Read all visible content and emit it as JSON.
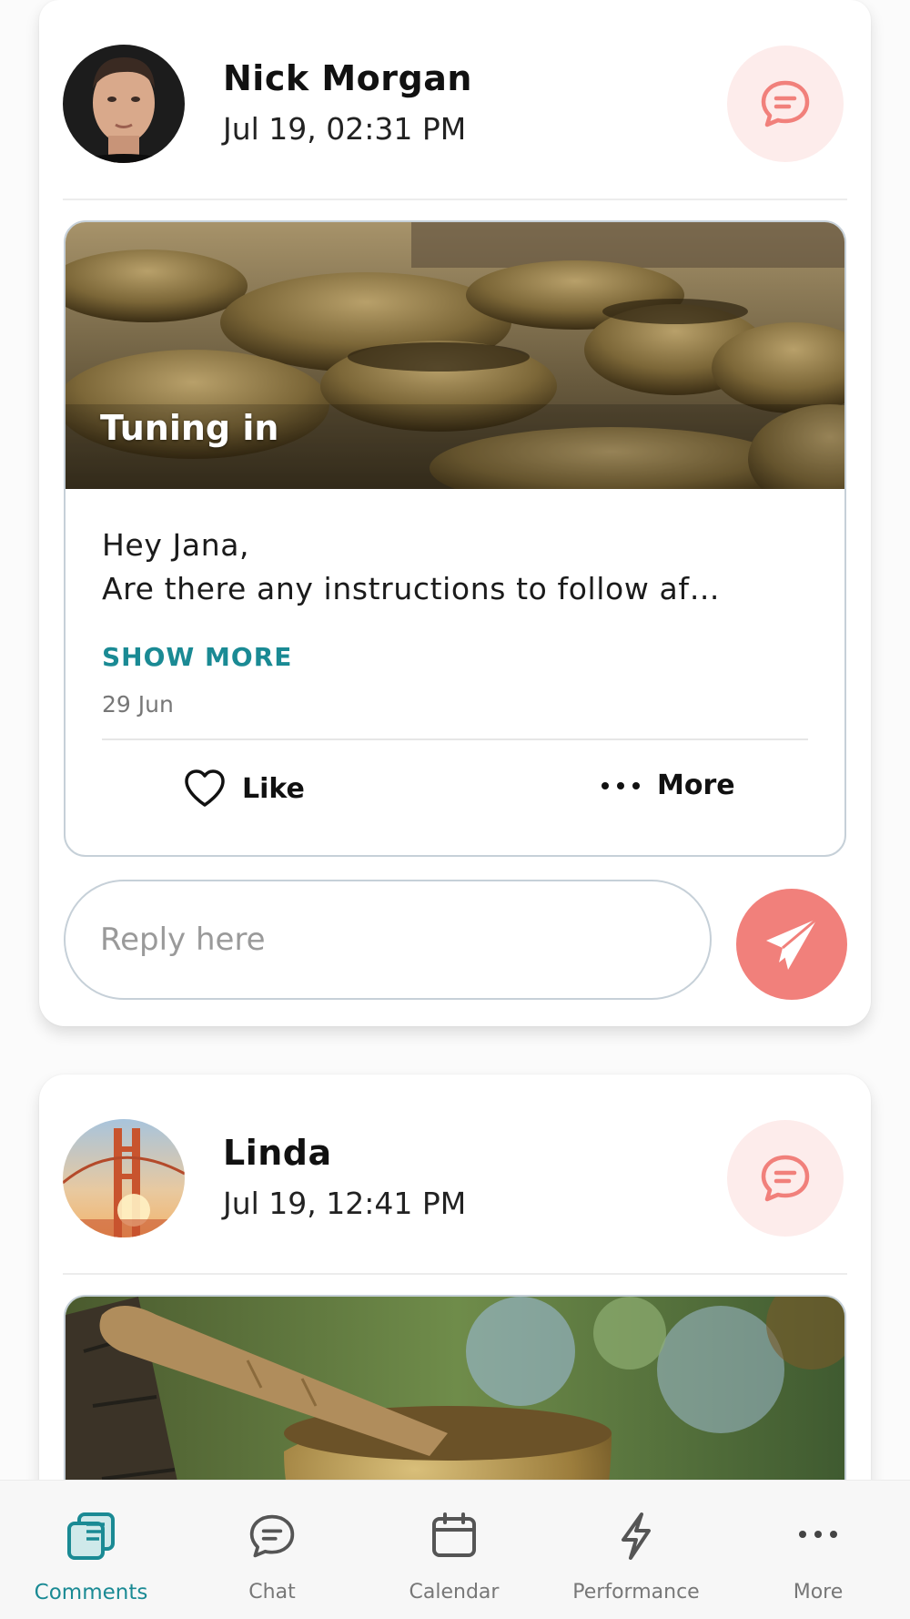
{
  "posts": [
    {
      "author": "Nick Morgan",
      "time": "Jul 19, 02:31 PM",
      "photo_title": "Tuning in",
      "message_line1": "Hey Jana,",
      "message_line2": " Are there any instructions to follow af…",
      "show_more": "SHOW MORE",
      "date": "29 Jun",
      "like_label": "Like",
      "more_label": "More",
      "reply_placeholder": "Reply here"
    },
    {
      "author": "Linda",
      "time": "Jul 19, 12:41 PM"
    }
  ],
  "nav": {
    "items": [
      {
        "label": "Comments",
        "icon": "comments-icon",
        "active": true
      },
      {
        "label": "Chat",
        "icon": "chat-icon",
        "active": false
      },
      {
        "label": "Calendar",
        "icon": "calendar-icon",
        "active": false
      },
      {
        "label": "Performance",
        "icon": "lightning-icon",
        "active": false
      },
      {
        "label": "More",
        "icon": "more-dots-icon",
        "active": false
      }
    ]
  },
  "colors": {
    "accent_teal": "#1a8a94",
    "coral": "#f1807b",
    "coral_light": "#fdeceb"
  }
}
